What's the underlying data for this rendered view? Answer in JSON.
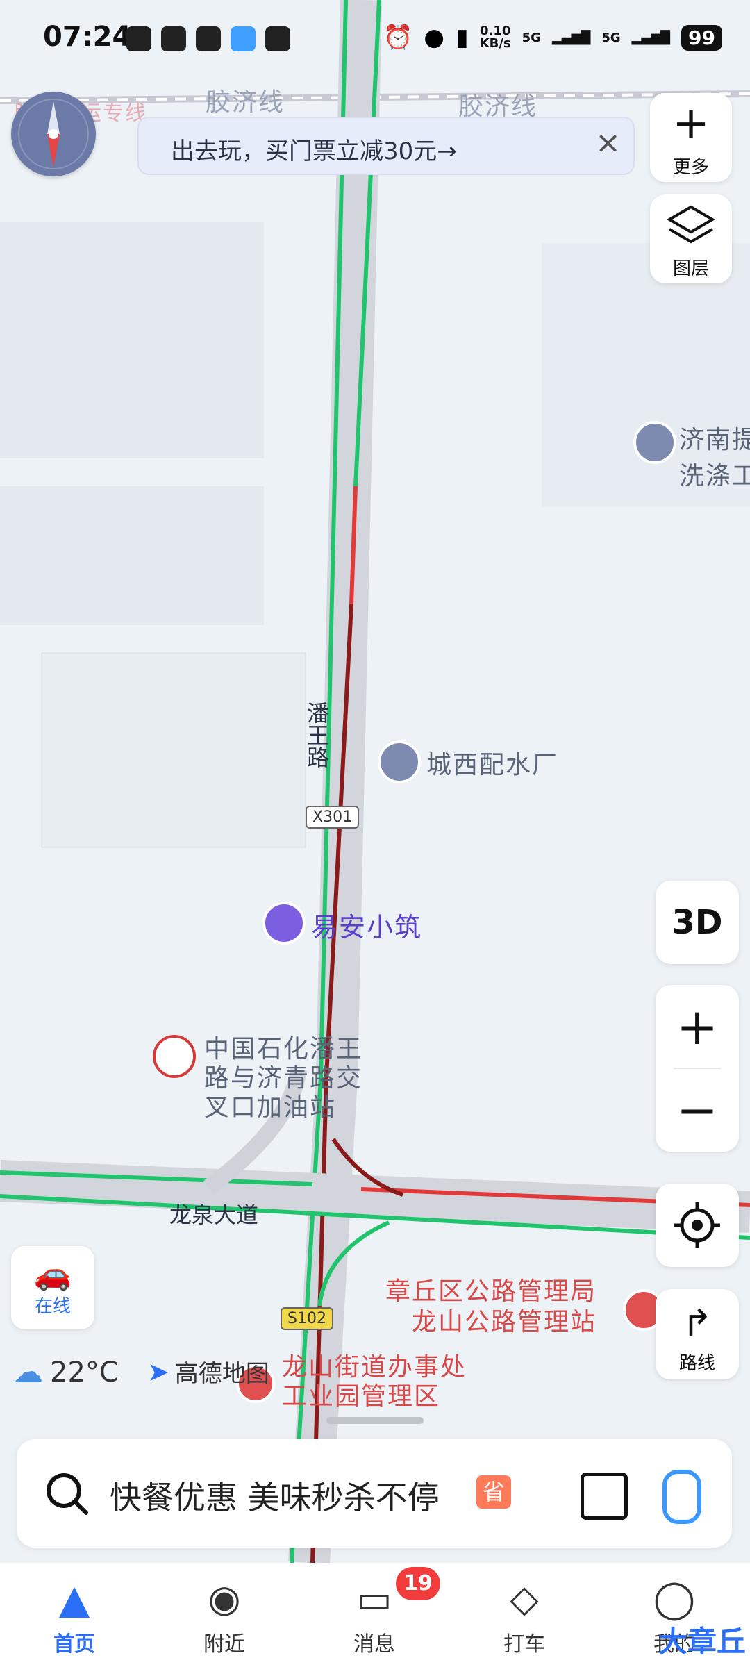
{
  "status_bar": {
    "time": "07:24",
    "net_speed": "0.10",
    "net_unit": "KB/s",
    "sig1": "5G",
    "sig2": "5G",
    "battery": "99"
  },
  "banner": {
    "text": "出去玩，买门票立减30元→"
  },
  "side_buttons": {
    "more": "更多",
    "layers": "图层",
    "three_d": "3D",
    "route": "路线",
    "online": "在线"
  },
  "map": {
    "rail_labels": [
      "胶济线",
      "胶济线"
    ],
    "rail_special": "胶济客运专线",
    "pois": {
      "jinan": "济南提\n洗涤工",
      "water_plant": "城西配水厂",
      "hotel": "易安小筑",
      "gas_station": "中国石化潘王\n路与济青路交\n叉口加油站",
      "highway_bureau": "章丘区公路管理局\n龙山公路管理站",
      "street_office": "龙山街道办事处\n工业园管理区"
    },
    "roads": {
      "panwang": "潘王路",
      "longquan": "龙泉大道",
      "shield_x301": "X301",
      "shield_s102": "S102"
    }
  },
  "weather": {
    "temp": "22°C",
    "icon": "rain-cloud-icon"
  },
  "brand": {
    "name": "高德地图"
  },
  "search": {
    "placeholder": "快餐优惠 美味秒杀不停",
    "badge": "省"
  },
  "tabs": [
    {
      "label": "首页",
      "icon": "navigation-arrow-icon"
    },
    {
      "label": "附近",
      "icon": "location-pin-icon"
    },
    {
      "label": "消息",
      "icon": "message-icon",
      "badge": "19"
    },
    {
      "label": "打车",
      "icon": "taxi-icon"
    },
    {
      "label": "我的",
      "icon": "user-icon"
    }
  ],
  "watermark": "大章丘",
  "colors": {
    "accent": "#2b6ff5",
    "traffic_green": "#1fc46c",
    "traffic_red": "#e03a3a",
    "traffic_darkred": "#8b1a1a"
  }
}
